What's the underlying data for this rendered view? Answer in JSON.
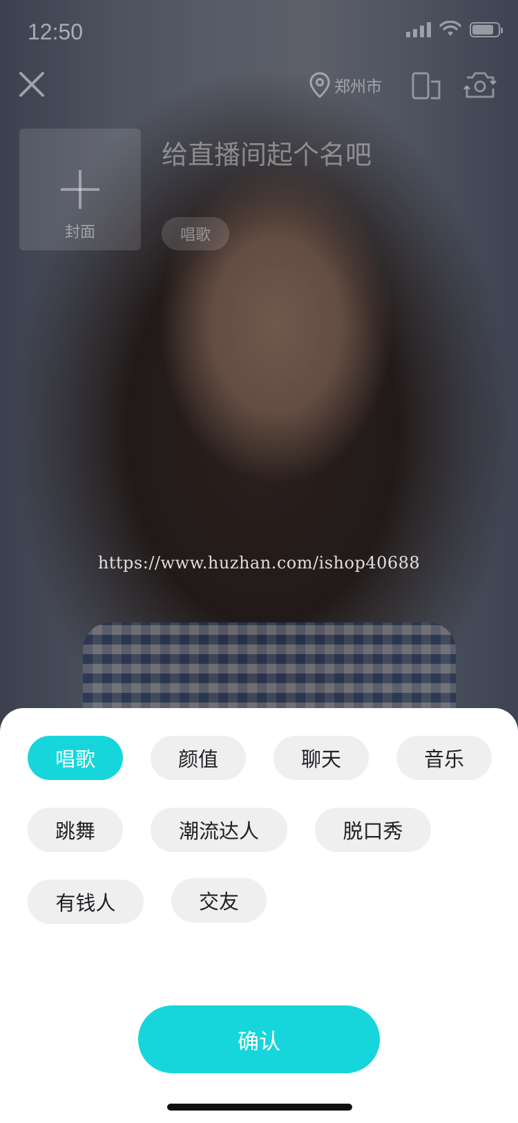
{
  "status_bar": {
    "time": "12:50"
  },
  "header": {
    "location": "郑州市",
    "icons": [
      "close-icon",
      "location-pin-icon",
      "phone-rotate-icon",
      "camera-flip-icon"
    ]
  },
  "cover": {
    "label": "封面"
  },
  "title_input": {
    "placeholder": "给直播间起个名吧"
  },
  "selected_category": "唱歌",
  "overlay": {
    "watermark": "https://www.huzhan.com/ishop40688"
  },
  "tags": [
    {
      "label": "唱歌",
      "selected": true
    },
    {
      "label": "颜值",
      "selected": false
    },
    {
      "label": "聊天",
      "selected": false
    },
    {
      "label": "音乐",
      "selected": false
    },
    {
      "label": "跳舞",
      "selected": false
    },
    {
      "label": "潮流达人",
      "selected": false
    },
    {
      "label": "脱口秀",
      "selected": false
    },
    {
      "label": "有钱人",
      "selected": false
    },
    {
      "label": "交友",
      "selected": false
    }
  ],
  "confirm_label": "确认",
  "colors": {
    "accent": "#16d6dc",
    "chip_bg": "#efefef",
    "chip_text": "#1f1f25"
  }
}
